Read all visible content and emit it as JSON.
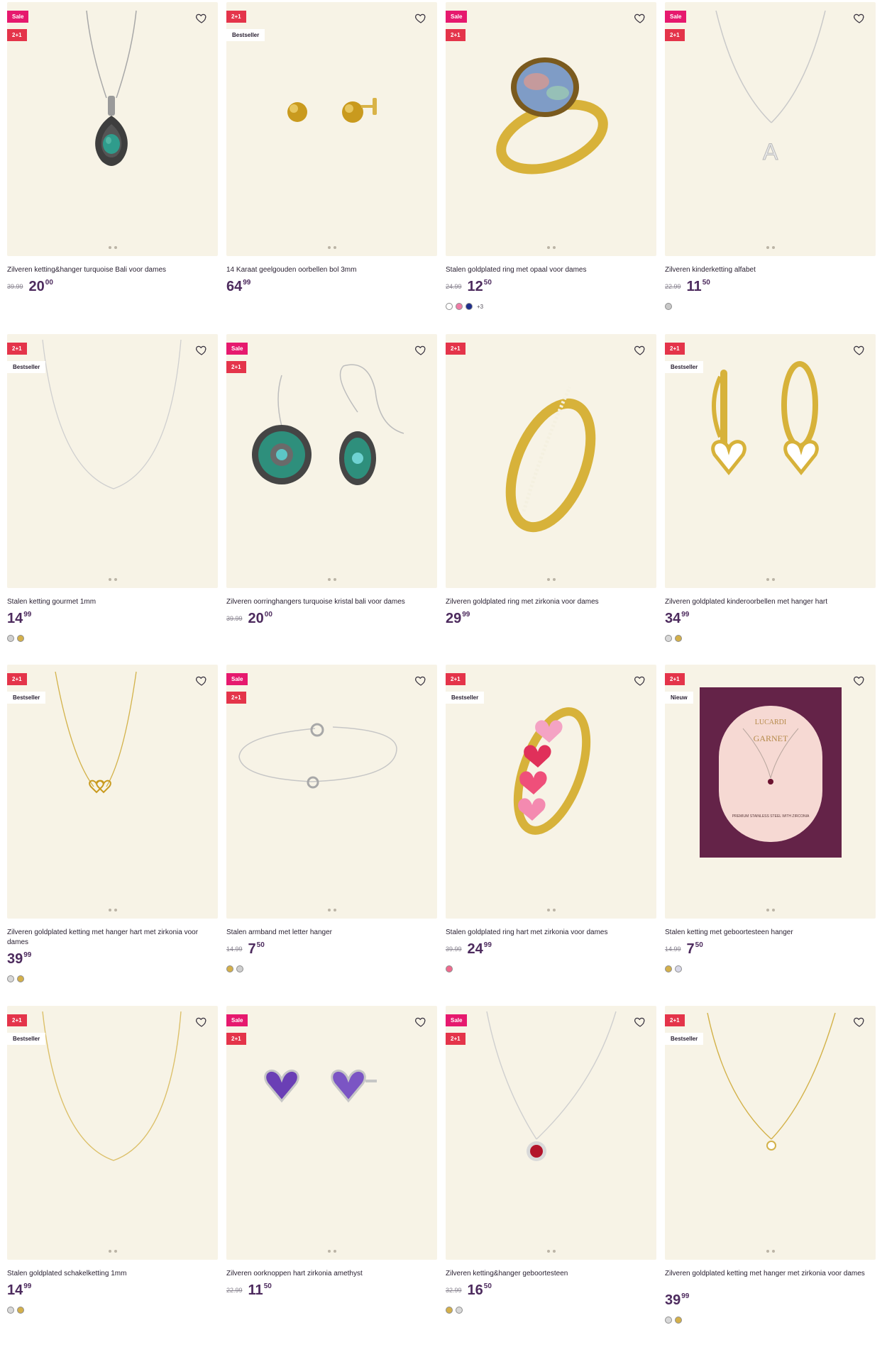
{
  "products": [
    {
      "title": "Zilveren ketting&hanger turquoise Bali voor dames",
      "badges": [
        "Sale",
        "2+1"
      ],
      "old_price": "39.99",
      "price_whole": "20",
      "price_cents": "00",
      "swatches": [],
      "more": "",
      "art": "pendant-turquoise"
    },
    {
      "title": "14 Karaat geelgouden oorbellen bol 3mm",
      "badges": [
        "2+1",
        "Bestseller"
      ],
      "old_price": "",
      "price_whole": "64",
      "price_cents": "99",
      "swatches": [],
      "more": "",
      "art": "gold-studs"
    },
    {
      "title": "Stalen goldplated ring met opaal voor dames",
      "badges": [
        "Sale",
        "2+1"
      ],
      "old_price": "24.99",
      "price_whole": "12",
      "price_cents": "50",
      "swatches": [
        "#ffffff",
        "#f07ca6",
        "#1f2f8c"
      ],
      "more": "+3",
      "art": "opal-ring"
    },
    {
      "title": "Zilveren kinderketting alfabet",
      "badges": [
        "Sale",
        "2+1"
      ],
      "old_price": "22.99",
      "price_whole": "11",
      "price_cents": "50",
      "swatches": [
        "#c8c8c8"
      ],
      "more": "",
      "art": "letter-necklace"
    },
    {
      "title": "Stalen ketting gourmet 1mm",
      "badges": [
        "2+1",
        "Bestseller"
      ],
      "old_price": "",
      "price_whole": "14",
      "price_cents": "99",
      "swatches": [
        "#d0d0d0",
        "#d4b04a"
      ],
      "more": "",
      "art": "silver-chain"
    },
    {
      "title": "Zilveren oorringhangers turquoise kristal bali voor dames",
      "badges": [
        "Sale",
        "2+1"
      ],
      "old_price": "39.99",
      "price_whole": "20",
      "price_cents": "00",
      "swatches": [],
      "more": "",
      "art": "bali-earrings"
    },
    {
      "title": "Zilveren goldplated ring met zirkonia voor dames",
      "badges": [
        "2+1"
      ],
      "old_price": "",
      "price_whole": "29",
      "price_cents": "99",
      "swatches": [],
      "more": "",
      "art": "gold-ring"
    },
    {
      "title": "Zilveren goldplated kinderoorbellen met hanger hart",
      "badges": [
        "2+1",
        "Bestseller"
      ],
      "old_price": "",
      "price_whole": "34",
      "price_cents": "99",
      "swatches": [
        "#d8d8d8",
        "#d4b04a"
      ],
      "more": "",
      "art": "heart-hoops"
    },
    {
      "title": "Zilveren goldplated ketting met hanger hart met zirkonia voor dames",
      "badges": [
        "2+1",
        "Bestseller"
      ],
      "old_price": "",
      "price_whole": "39",
      "price_cents": "99",
      "swatches": [
        "#d8d8d8",
        "#d4b04a"
      ],
      "more": "",
      "art": "gold-heart-necklace"
    },
    {
      "title": "Stalen armband met letter hanger",
      "badges": [
        "Sale",
        "2+1"
      ],
      "old_price": "14.99",
      "price_whole": "7",
      "price_cents": "50",
      "swatches": [
        "#d4b04a",
        "#cfcfcf"
      ],
      "more": "",
      "art": "bracelet"
    },
    {
      "title": "Stalen goldplated ring hart met zirkonia voor dames",
      "badges": [
        "2+1",
        "Bestseller"
      ],
      "old_price": "39.99",
      "price_whole": "24",
      "price_cents": "99",
      "swatches": [
        "#f06a8e"
      ],
      "more": "",
      "art": "heart-ring"
    },
    {
      "title": "Stalen ketting met geboortesteen hanger",
      "badges": [
        "2+1",
        "Nieuw"
      ],
      "old_price": "14.99",
      "price_whole": "7",
      "price_cents": "50",
      "swatches": [
        "#d4b04a",
        "#d8d8e8"
      ],
      "more": "",
      "art": "gift-box"
    },
    {
      "title": "Stalen goldplated schakelketting 1mm",
      "badges": [
        "2+1",
        "Bestseller"
      ],
      "old_price": "",
      "price_whole": "14",
      "price_cents": "99",
      "swatches": [
        "#d8d8d8",
        "#d4b04a"
      ],
      "more": "",
      "art": "gold-chain"
    },
    {
      "title": "Zilveren oorknoppen hart zirkonia amethyst",
      "badges": [
        "Sale",
        "2+1"
      ],
      "old_price": "22.99",
      "price_whole": "11",
      "price_cents": "50",
      "swatches": [],
      "more": "",
      "art": "amethyst-studs"
    },
    {
      "title": "Zilveren ketting&hanger geboortesteen",
      "badges": [
        "Sale",
        "2+1"
      ],
      "old_price": "32.99",
      "price_whole": "16",
      "price_cents": "50",
      "swatches": [
        "#d4b04a",
        "#d8d8d8"
      ],
      "more": "",
      "art": "red-pendant"
    },
    {
      "title": "Zilveren goldplated ketting met hanger met zirkonia voor dames",
      "badges": [
        "2+1",
        "Bestseller"
      ],
      "old_price": "",
      "price_whole": "39",
      "price_cents": "99",
      "swatches": [
        "#d8d8d8",
        "#d4b04a"
      ],
      "more": "",
      "art": "gold-solitaire"
    }
  ],
  "gift_box": {
    "brand": "LUCARDI",
    "word": "GARNET",
    "caption": "PREMIUM STAINLESS STEEL WITH ZIRCONIA"
  }
}
